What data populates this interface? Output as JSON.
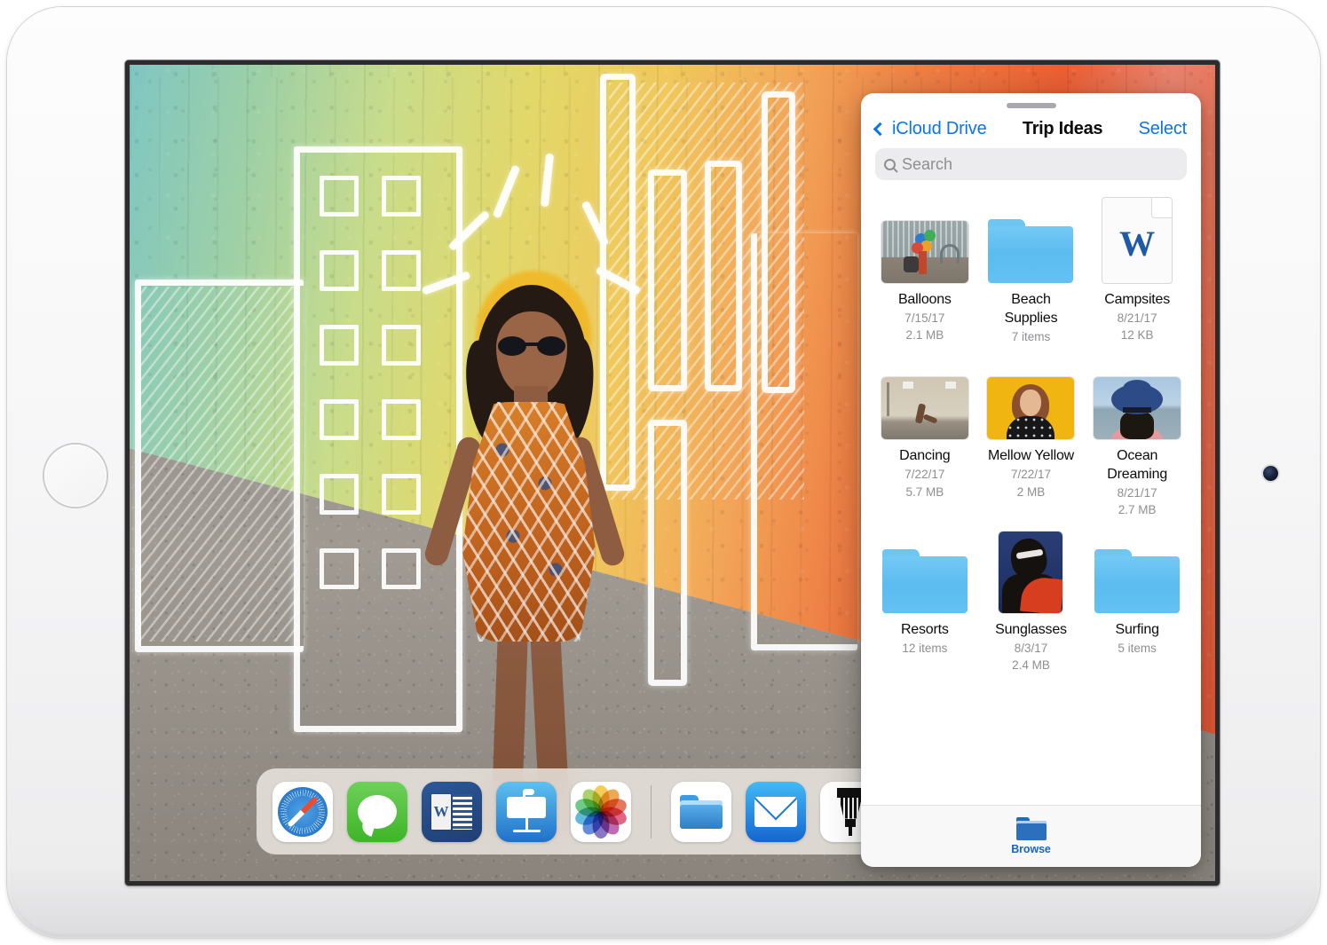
{
  "device": {
    "name": "iPad",
    "home_button": "home-button",
    "camera": "front-camera"
  },
  "wallpaper": {
    "description": "Street mural photo — rainbow-washed brick wall with white chalk building outlines and a woman in a patterned dress"
  },
  "dock": {
    "apps": [
      {
        "name": "Safari",
        "icon": "safari-icon"
      },
      {
        "name": "Messages",
        "icon": "messages-icon"
      },
      {
        "name": "Word",
        "icon": "word-icon"
      },
      {
        "name": "Keynote",
        "icon": "keynote-icon"
      },
      {
        "name": "Photos",
        "icon": "photos-icon"
      }
    ],
    "recents": [
      {
        "name": "Files",
        "icon": "files-icon"
      },
      {
        "name": "Mail",
        "icon": "mail-icon"
      },
      {
        "name": "Sketch",
        "icon": "sketch-tool-icon"
      }
    ]
  },
  "slideover": {
    "app": "Files",
    "drag_handle": "drag-handle",
    "nav": {
      "back_label": "iCloud Drive",
      "back_icon": "chevron-left-icon",
      "title": "Trip Ideas",
      "select_label": "Select"
    },
    "search": {
      "placeholder": "Search",
      "value": "",
      "icon": "search-icon"
    },
    "files": [
      {
        "name": "Balloons",
        "kind": "photo",
        "thumb": "balloons-thumbnail",
        "orientation": "landscape",
        "date": "7/15/17",
        "size": "2.1 MB"
      },
      {
        "name": "Beach Supplies",
        "kind": "folder",
        "thumb": "folder-icon",
        "date": "",
        "size": "7 items"
      },
      {
        "name": "Campsites",
        "kind": "document",
        "thumb": "word-document-icon",
        "date": "8/21/17",
        "size": "12 KB"
      },
      {
        "name": "Dancing",
        "kind": "photo",
        "thumb": "dancing-thumbnail",
        "orientation": "landscape",
        "date": "7/22/17",
        "size": "5.7 MB"
      },
      {
        "name": "Mellow Yellow",
        "kind": "photo",
        "thumb": "mellow-yellow-thumbnail",
        "orientation": "landscape",
        "date": "7/22/17",
        "size": "2 MB"
      },
      {
        "name": "Ocean Dreaming",
        "kind": "photo",
        "thumb": "ocean-dreaming-thumbnail",
        "orientation": "landscape",
        "date": "8/21/17",
        "size": "2.7 MB"
      },
      {
        "name": "Resorts",
        "kind": "folder",
        "thumb": "folder-icon",
        "date": "",
        "size": "12 items"
      },
      {
        "name": "Sunglasses",
        "kind": "photo",
        "thumb": "sunglasses-thumbnail",
        "orientation": "portrait",
        "date": "8/3/17",
        "size": "2.4 MB"
      },
      {
        "name": "Surfing",
        "kind": "folder",
        "thumb": "folder-icon",
        "date": "",
        "size": "5 items"
      }
    ],
    "tabbar": {
      "browse_label": "Browse",
      "browse_icon": "folder-icon"
    }
  },
  "colors": {
    "accent_blue": "#0a74ef",
    "tab_blue": "#1268c3",
    "folder_blue": "#5cbcf0",
    "secondary_text": "#8e8e93",
    "primary_text": "#0b0b0d",
    "word_blue": "#1f5aa8"
  }
}
